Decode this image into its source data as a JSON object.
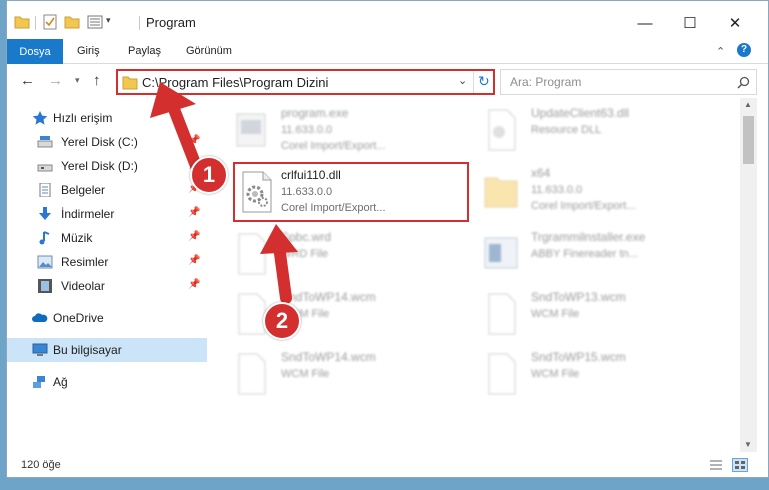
{
  "window": {
    "title": "Program",
    "min_glyph": "—",
    "max_glyph": "☐",
    "close_glyph": "✕",
    "help_glyph": "?",
    "collapse_glyph": "⌃"
  },
  "ribbon": {
    "tabs": [
      "Dosya",
      "Giriş",
      "Paylaş",
      "Görünüm"
    ]
  },
  "address": {
    "path": "C:\\Program Files\\Program Dizini",
    "search_placeholder": "Ara: Program"
  },
  "nav": {
    "items": [
      {
        "label": "Hızlı erişim",
        "icon": "star-icon",
        "pinned": false
      },
      {
        "label": "Yerel Disk (C:)",
        "icon": "drive-icon",
        "pinned": true
      },
      {
        "label": "Yerel Disk (D:)",
        "icon": "drive-icon",
        "pinned": true
      },
      {
        "label": "Belgeler",
        "icon": "documents-icon",
        "pinned": true
      },
      {
        "label": "İndirmeler",
        "icon": "download-icon",
        "pinned": true
      },
      {
        "label": "Müzik",
        "icon": "music-icon",
        "pinned": true
      },
      {
        "label": "Resimler",
        "icon": "pictures-icon",
        "pinned": true
      },
      {
        "label": "Videolar",
        "icon": "video-icon",
        "pinned": true
      },
      {
        "label": "OneDrive",
        "icon": "cloud-icon",
        "pinned": false
      },
      {
        "label": "Bu bilgisayar",
        "icon": "computer-icon",
        "pinned": false
      },
      {
        "label": "Ağ",
        "icon": "network-icon",
        "pinned": false
      }
    ]
  },
  "files": [
    {
      "name": "program.exe",
      "line2": "11.633.0.0",
      "line3": "Corel Import/Export...",
      "icon": "exe-icon"
    },
    {
      "name": "UpdateClient63.dll",
      "line2": "Resource DLL",
      "line3": "",
      "icon": "dll-icon"
    },
    {
      "name": "crlfui110.dll",
      "line2": "11.633.0.0",
      "line3": "Corel Import/Export...",
      "icon": "dll-gear-icon"
    },
    {
      "name": "x64",
      "line2": "11.633.0.0",
      "line3": "Corel Import/Export...",
      "icon": "folder-icon"
    },
    {
      "name": "Spbc.wrd",
      "line2": "WRD File",
      "line3": "",
      "icon": "file-icon"
    },
    {
      "name": "Trgrammilnstaller.exe",
      "line2": "ABBY Finereader tn...",
      "line3": "",
      "icon": "installer-icon"
    },
    {
      "name": "SndToWP14.wcm",
      "line2": "WCM File",
      "line3": "",
      "icon": "file-icon"
    },
    {
      "name": "SndToWP13.wcm",
      "line2": "WCM File",
      "line3": "",
      "icon": "file-icon"
    },
    {
      "name": "SndToWP14.wcm",
      "line2": "WCM File",
      "line3": "",
      "icon": "file-icon"
    },
    {
      "name": "SndToWP15.wcm",
      "line2": "WCM File",
      "line3": "",
      "icon": "file-icon"
    }
  ],
  "status": {
    "item_count": "120 öğe"
  },
  "callouts": [
    "1",
    "2"
  ],
  "colors": {
    "accent": "#1979ca",
    "highlight": "#d32f2f"
  }
}
